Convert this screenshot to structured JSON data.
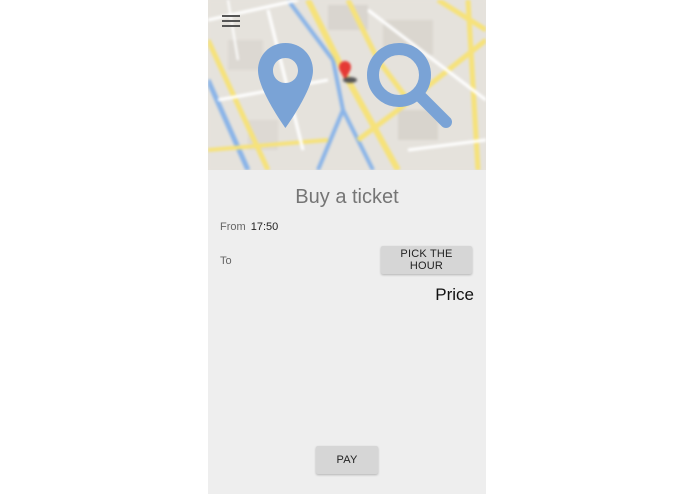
{
  "map": {
    "menu_icon": "hamburger-menu-icon",
    "overlay_icons": [
      "location-pin-icon",
      "search-icon"
    ],
    "marker_icon": "map-marker-icon",
    "colors": {
      "overlay_icon": "#7aa3d6",
      "road": "#f6e27a",
      "water": "#8ab4e8",
      "marker": "#e53935"
    }
  },
  "ticket": {
    "title": "Buy a ticket",
    "from_label": "From",
    "from_time": "17:50",
    "to_label": "To",
    "pick_button_label": "PICK THE HOUR",
    "price_label": "Price",
    "pay_button_label": "PAY"
  }
}
